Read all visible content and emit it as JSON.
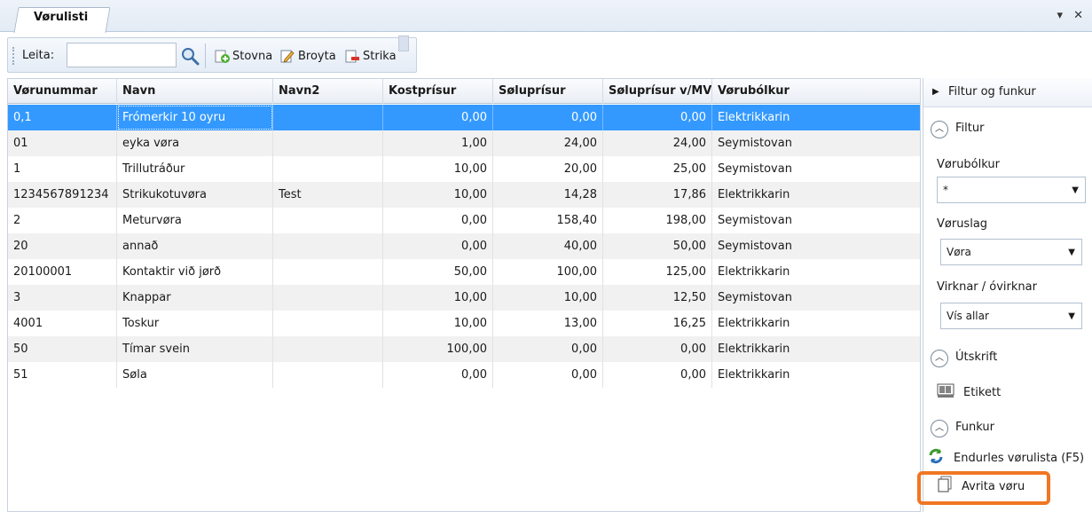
{
  "window": {
    "tab_title": "Vørulisti",
    "controls": "▾ ✕"
  },
  "toolbar": {
    "search_label": "Leita:",
    "search_value": "",
    "create_label": "Stovna",
    "edit_label": "Broyta",
    "delete_label": "Strika"
  },
  "grid": {
    "columns": [
      "Vørunummar",
      "Navn",
      "Navn2",
      "Kostprísur",
      "Søluprísur",
      "Søluprísur v/MV",
      "Vørubólkur"
    ],
    "rows": [
      {
        "nr": "0,1",
        "name": "Frómerkir 10 oyru",
        "name2": "",
        "cost": "0,00",
        "price": "0,00",
        "price_vat": "0,00",
        "group": "Elektrikkarin"
      },
      {
        "nr": "01",
        "name": "eyka vøra",
        "name2": "",
        "cost": "1,00",
        "price": "24,00",
        "price_vat": "24,00",
        "group": "Seymistovan"
      },
      {
        "nr": "1",
        "name": "Trillutráður",
        "name2": "",
        "cost": "10,00",
        "price": "20,00",
        "price_vat": "25,00",
        "group": "Seymistovan"
      },
      {
        "nr": "1234567891234",
        "name": "Strikukotuvøra",
        "name2": "Test",
        "cost": "10,00",
        "price": "14,28",
        "price_vat": "17,86",
        "group": "Elektrikkarin"
      },
      {
        "nr": "2",
        "name": "Meturvøra",
        "name2": "",
        "cost": "0,00",
        "price": "158,40",
        "price_vat": "198,00",
        "group": "Seymistovan"
      },
      {
        "nr": "20",
        "name": "annað",
        "name2": "",
        "cost": "0,00",
        "price": "40,00",
        "price_vat": "50,00",
        "group": "Seymistovan"
      },
      {
        "nr": "20100001",
        "name": "Kontaktir við jørð",
        "name2": "",
        "cost": "50,00",
        "price": "100,00",
        "price_vat": "125,00",
        "group": "Elektrikkarin"
      },
      {
        "nr": "3",
        "name": "Knappar",
        "name2": "",
        "cost": "10,00",
        "price": "10,00",
        "price_vat": "12,50",
        "group": "Seymistovan"
      },
      {
        "nr": "4001",
        "name": "Toskur",
        "name2": "",
        "cost": "10,00",
        "price": "13,00",
        "price_vat": "16,25",
        "group": "Elektrikkarin"
      },
      {
        "nr": "50",
        "name": "Tímar svein",
        "name2": "",
        "cost": "100,00",
        "price": "0,00",
        "price_vat": "0,00",
        "group": "Elektrikkarin"
      },
      {
        "nr": "51",
        "name": "Søla",
        "name2": "",
        "cost": "0,00",
        "price": "0,00",
        "price_vat": "0,00",
        "group": "Elektrikkarin"
      }
    ],
    "selected_row": 0
  },
  "panel": {
    "header": "Filtur og funkur",
    "filter_section": "Filtur",
    "group_label": "Vørubólkur",
    "group_value": "*",
    "type_label": "Vøruslag",
    "type_value": "Vøra",
    "active_label": "Virknar / óvirknar",
    "active_value": "Vís allar",
    "print_section": "Útskrift",
    "label_item": "Etikett",
    "functions_section": "Funkur",
    "refresh_item": "Endurles vørulista (F5)",
    "copy_item": "Avrita vøru"
  },
  "colors": {
    "selection": "#3399ff",
    "highlight": "#f07623"
  }
}
